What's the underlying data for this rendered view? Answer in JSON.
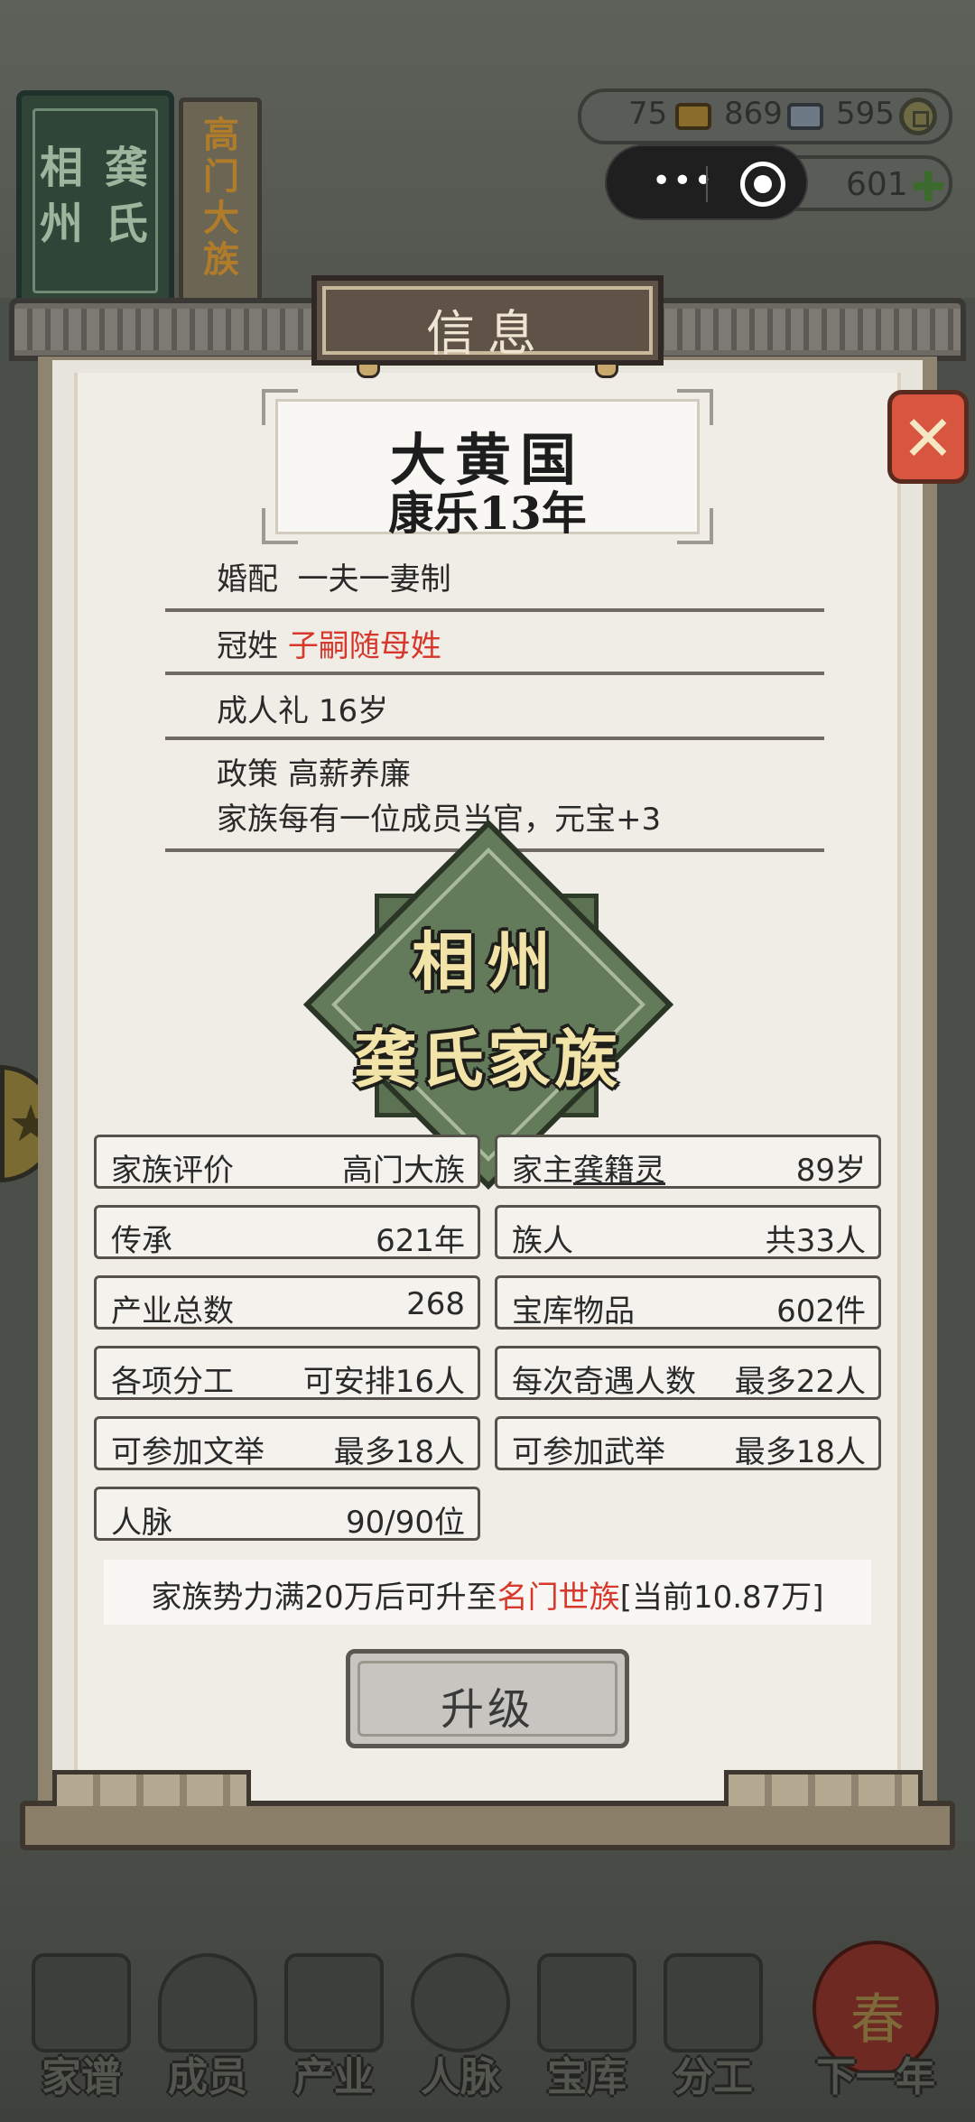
{
  "background": {
    "banner_book": [
      "相",
      "州",
      "龚",
      "氏"
    ],
    "banner_scroll": [
      "高",
      "门",
      "大",
      "族"
    ],
    "resources": {
      "gold": "75",
      "silver": "869",
      "coins": "595",
      "energy": "601"
    }
  },
  "modal": {
    "title": "信息",
    "country": {
      "name": "大黄国",
      "era": "康乐13年"
    },
    "rules": [
      {
        "key": "婚配",
        "value": "一夫一妻制"
      },
      {
        "key": "冠姓",
        "value": "子嗣随母姓"
      },
      {
        "key": "成人礼",
        "value": "16岁"
      },
      {
        "key": "政策",
        "value": "高薪养廉",
        "note": "家族每有一位成员当官，元宝+3"
      }
    ],
    "emblem": {
      "line1": "相州",
      "line2": "龚氏家族"
    },
    "stats": {
      "rating": {
        "label": "家族评价",
        "value": "高门大族"
      },
      "head": {
        "label": "家主",
        "name": "龚籍灵",
        "age": "89岁"
      },
      "legacy": {
        "label": "传承",
        "value": "621年"
      },
      "members": {
        "label": "族人",
        "value": "共33人"
      },
      "industry": {
        "label": "产业总数",
        "value": "268"
      },
      "treasury": {
        "label": "宝库物品",
        "value": "602件"
      },
      "work": {
        "label": "各项分工",
        "value": "可安排16人"
      },
      "adventure": {
        "label": "每次奇遇人数",
        "value": "最多22人"
      },
      "civil_exam": {
        "label": "可参加文举",
        "value": "最多18人"
      },
      "military_exam": {
        "label": "可参加武举",
        "value": "最多18人"
      },
      "network": {
        "label": "人脉",
        "value": "90/90位"
      }
    },
    "notice": {
      "prefix": "家族势力满20万后可升至",
      "target": "名门世族",
      "suffix": "[当前10.87万]"
    },
    "upgrade_label": "升级",
    "close_icon": "✕"
  },
  "nav": [
    {
      "label": "家谱",
      "icon": "book-icon"
    },
    {
      "label": "成员",
      "icon": "person-icon"
    },
    {
      "label": "产业",
      "icon": "building-icon"
    },
    {
      "label": "人脉",
      "icon": "network-icon"
    },
    {
      "label": "宝库",
      "icon": "chest-icon"
    },
    {
      "label": "分工",
      "icon": "scroll-icon"
    },
    {
      "label": "下一年",
      "icon": "lantern-icon",
      "lantern_text": "春"
    }
  ],
  "colors": {
    "accent_red": "#d8372c",
    "accent_orange": "#e59a33",
    "emblem_green": "#647b5b",
    "close_red": "#d8553f"
  }
}
